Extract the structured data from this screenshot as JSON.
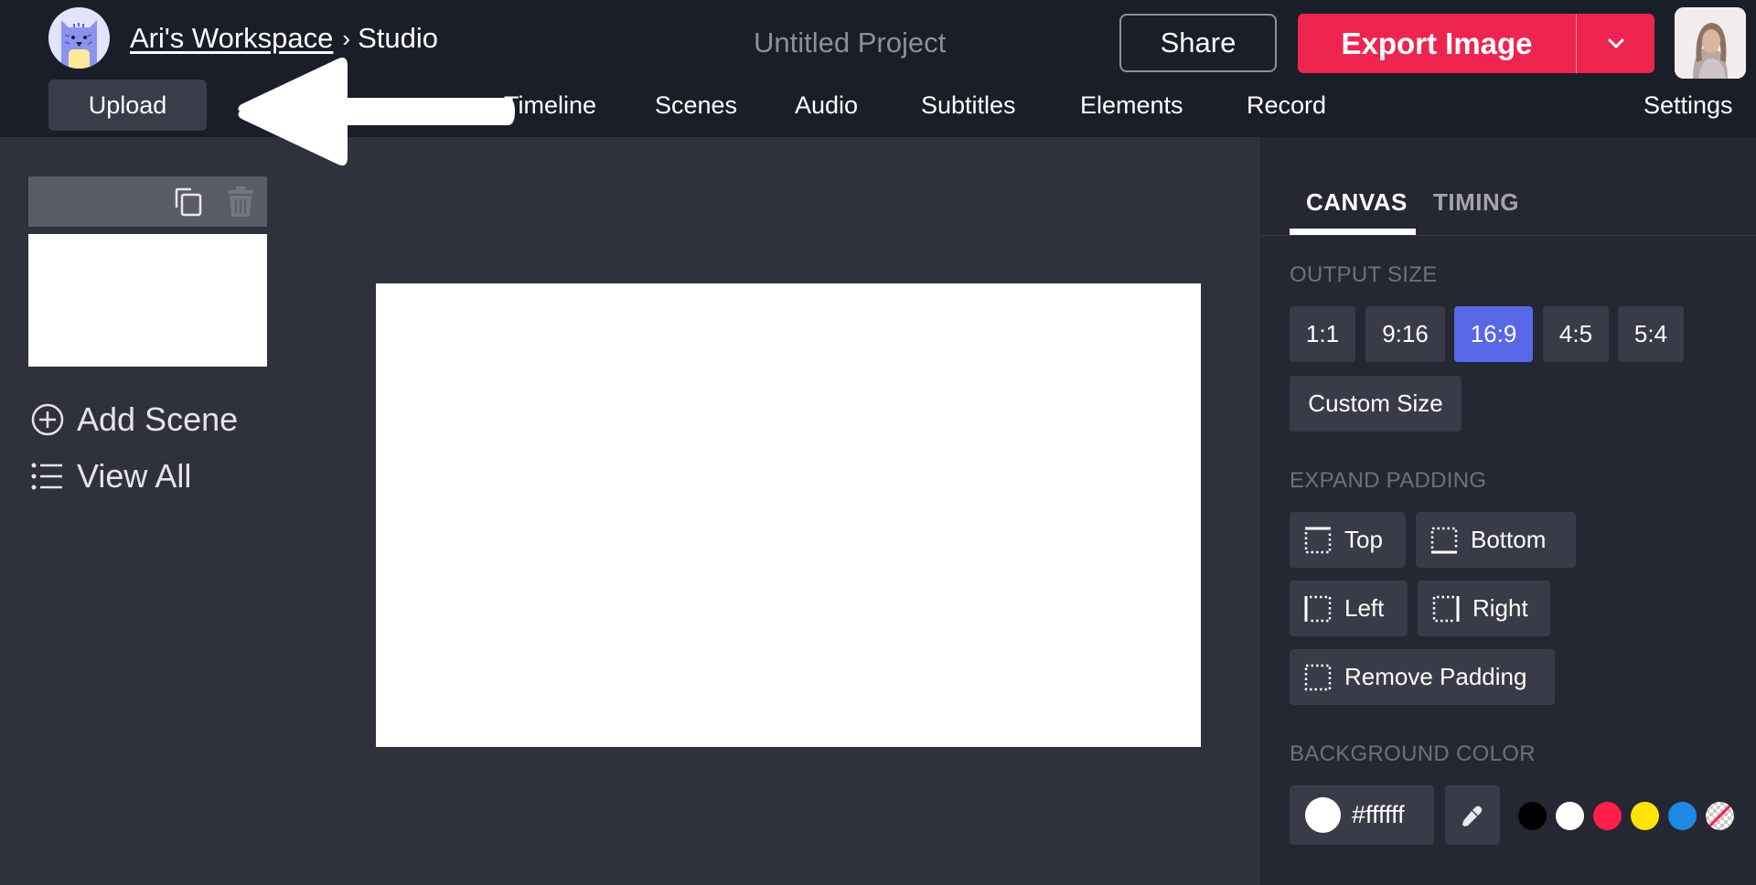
{
  "header": {
    "workspace_name": "Ari's Workspace",
    "separator": "›",
    "section": "Studio",
    "project_title": "Untitled Project",
    "share_label": "Share",
    "export_label": "Export Image",
    "upload_label": "Upload",
    "nav": [
      "Timeline",
      "Scenes",
      "Audio",
      "Subtitles",
      "Elements",
      "Record"
    ],
    "settings_label": "Settings"
  },
  "sidebar": {
    "add_scene_label": "Add Scene",
    "view_all_label": "View All"
  },
  "panel": {
    "tabs": [
      "CANVAS",
      "TIMING"
    ],
    "active_tab": "CANVAS",
    "output_size_label": "OUTPUT SIZE",
    "ratios": [
      "1:1",
      "9:16",
      "16:9",
      "4:5",
      "5:4"
    ],
    "selected_ratio": "16:9",
    "custom_size_label": "Custom Size",
    "expand_padding_label": "EXPAND PADDING",
    "padding_buttons": {
      "top": "Top",
      "bottom": "Bottom",
      "left": "Left",
      "right": "Right",
      "remove": "Remove Padding"
    },
    "background_color_label": "BACKGROUND COLOR",
    "background_color_value": "#ffffff",
    "swatches": [
      "#000000",
      "#ffffff",
      "#ff1f4b",
      "#ffe500",
      "#1e88e5",
      "transparent"
    ]
  },
  "colors": {
    "accent": "#5867e6",
    "export": "#ee2450",
    "header_bg": "#1a1e29",
    "stage_bg": "#2f323d",
    "panel_bg": "#252833"
  }
}
